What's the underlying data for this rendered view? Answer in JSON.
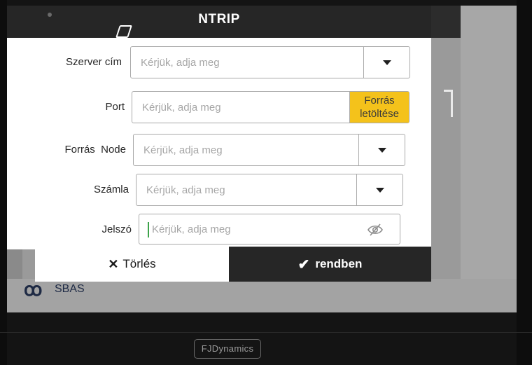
{
  "dialog": {
    "title": "NTRIP"
  },
  "form": {
    "server": {
      "label": "Szerver cím",
      "placeholder": "Kérjük, adja meg"
    },
    "port": {
      "label": "Port",
      "placeholder": "Kérjük, adja meg",
      "fetch_button_line1": "Forrás",
      "fetch_button_line2": "letöltése"
    },
    "node": {
      "label": "Forrás  Node",
      "placeholder": "Kérjük, adja meg"
    },
    "account": {
      "label": "Számla",
      "placeholder": "Kérjük, adja meg"
    },
    "password": {
      "label": "Jelszó",
      "placeholder": "Kérjük, adja meg"
    }
  },
  "footer": {
    "cancel_label": "Törlés",
    "ok_label": "rendben"
  },
  "background": {
    "sbas_label": "SBAS"
  },
  "device": {
    "brand": "FJDynamics"
  },
  "colors": {
    "accent_yellow": "#f4c21b",
    "titlebar": "#262626",
    "cursor": "#3da34a"
  },
  "icons": [
    "dropdown-caret-icon",
    "eye-hidden-icon",
    "close-x-icon",
    "checkmark-icon",
    "edit-icon",
    "satellite-icon"
  ]
}
